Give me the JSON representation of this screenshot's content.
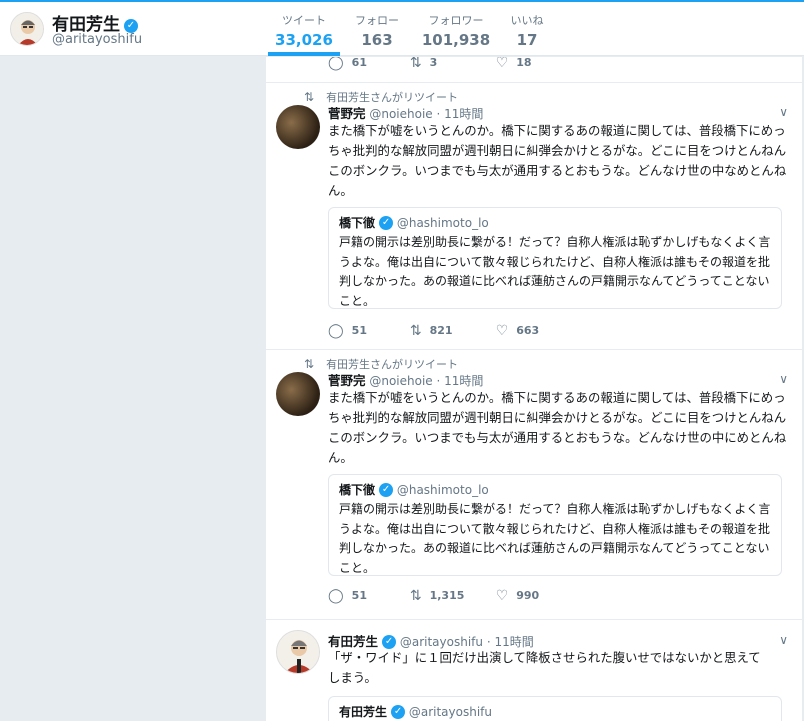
{
  "profile": {
    "name": "有田芳生",
    "handle": "@aritayoshifu"
  },
  "stats": [
    {
      "label": "ツイート",
      "value": "33,026"
    },
    {
      "label": "フォロー",
      "value": "163"
    },
    {
      "label": "フォロワー",
      "value": "101,938"
    },
    {
      "label": "いいね",
      "value": "17"
    }
  ],
  "prev_tweet_actions": {
    "replies": "61",
    "retweets": "3",
    "likes": "18"
  },
  "tweets": [
    {
      "retweet_by": "有田芳生さんがリツイート",
      "name": "菅野完",
      "handle": "@noiehoie",
      "time": "11時間",
      "text": "また橋下が嘘をいうとんのか。橋下に関するあの報道に関しては、普段橋下にめっちゃ批判的な解放同盟が週刊朝日に糾弾会かけとるがな。どこに目をつけとんねんこのボンクラ。いつまでも与太が通用するとおもうな。どんなけ世の中なめとんねん。",
      "quote": {
        "name": "橋下徹",
        "handle": "@hashimoto_lo",
        "text": "戸籍の開示は差別助長に繋がる！だって？自称人権派は恥ずかしげもなくよく言うよな。俺は出自について散々報じられたけど、自称人権派は誰もその報道を批判しなかった。あの報道に比べれば蓮舫さんの戸籍開示なんてどうってことないこと。"
      },
      "replies": "51",
      "retweets": "821",
      "likes": "663"
    },
    {
      "retweet_by": "有田芳生さんがリツイート",
      "name": "菅野完",
      "handle": "@noiehoie",
      "time": "11時間",
      "text": "また橋下が嘘をいうとんのか。橋下に関するあの報道に関しては、普段橋下にめっちゃ批判的な解放同盟が週刊朝日に糾弾会かけとるがな。どこに目をつけとんねんこのボンクラ。いつまでも与太が通用するとおもうな。どんなけ世の中にめとんねん。",
      "quote": {
        "name": "橋下徹",
        "handle": "@hashimoto_lo",
        "text": "戸籍の開示は差別助長に繋がる！だって？自称人権派は恥ずかしげもなくよく言うよな。俺は出自について散々報じられたけど、自称人権派は誰もその報道を批判しなかった。あの報道に比べれば蓮舫さんの戸籍開示なんてどうってことないこと。"
      },
      "replies": "51",
      "retweets": "1,315",
      "likes": "990"
    },
    {
      "name": "有田芳生",
      "handle": "@aritayoshifu",
      "time": "11時間",
      "text": "「ザ・ワイド」に１回だけ出演して降板させられた腹いせではないかと思えてしまう。",
      "quote": {
        "name": "有田芳生",
        "handle": "@aritayoshifu"
      }
    }
  ],
  "colors": {
    "accent": "#1da1f2",
    "background": "#e6ecf0",
    "muted": "#657786"
  }
}
